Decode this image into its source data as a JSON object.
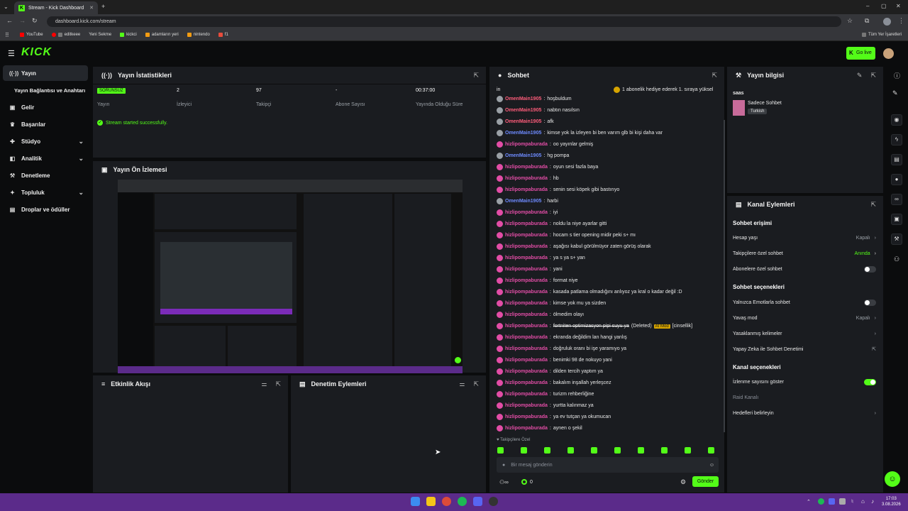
{
  "browser": {
    "tab_title": "Stream - Kick Dashboard",
    "url": "dashboard.kick.com/stream",
    "bookmarks": [
      "YouTube",
      "editkeee",
      "Yeni Sekme",
      "kickci",
      "adamların yeri",
      "nintendo",
      "f1"
    ],
    "all_bookmarks": "Tüm Yer İşaretleri"
  },
  "header": {
    "logo": "KICK",
    "go_live": "Go live"
  },
  "sidebar": {
    "items": [
      {
        "label": "Yayın",
        "icon": "broadcast-icon"
      },
      {
        "label": "Yayın Bağlantısı ve Anahtarı",
        "icon": ""
      },
      {
        "label": "Gelir",
        "icon": "wallet-icon"
      },
      {
        "label": "Başarılar",
        "icon": "trophy-icon"
      },
      {
        "label": "Stüdyo",
        "icon": "studio-icon"
      },
      {
        "label": "Analitik",
        "icon": "analytics-icon"
      },
      {
        "label": "Denetleme",
        "icon": "wrench-icon"
      },
      {
        "label": "Topluluk",
        "icon": "community-icon"
      },
      {
        "label": "Droplar ve ödüller",
        "icon": "gift-icon"
      }
    ]
  },
  "stats": {
    "title": "Yayın İstatistikleri",
    "status_badge": "SORUNSUZ",
    "status_label": "Yayın",
    "viewers": "2",
    "viewers_label": "İzleyici",
    "followers": "97",
    "followers_label": "Takipçi",
    "subs": "-",
    "subs_label": "Abone Sayısı",
    "duration": "00:37:00",
    "duration_label": "Yayında Olduğu Süre",
    "success": "Stream started successfully."
  },
  "preview": {
    "title": "Yayın Ön İzlemesi"
  },
  "activity": {
    "title": "Etkinlik Akışı"
  },
  "moderation": {
    "title": "Denetim Eylemleri"
  },
  "chat": {
    "title": "Sohbet",
    "partial_top": "in",
    "gift_banner": "1 abonelik hediye ederek 1. sıraya yüksel",
    "messages": [
      {
        "user": "OmenMain1905",
        "color": "red",
        "badge": "g",
        "text": "hoşbuldum"
      },
      {
        "user": "OmenMain1905",
        "color": "red",
        "badge": "g",
        "text": "nabtın nasılsın"
      },
      {
        "user": "OmenMain1905",
        "color": "red",
        "badge": "g",
        "text": "afk"
      },
      {
        "user": "OmenMain1905",
        "color": "blue",
        "badge": "g",
        "text": "kimse yok la izleyen bi ben varım glb bi kişi daha var"
      },
      {
        "user": "hizlipompaburada",
        "color": "pink",
        "badge": "p",
        "text": "oo yayınlar gelmiş"
      },
      {
        "user": "OmenMain1905",
        "color": "blue",
        "badge": "g",
        "text": "hg pompa"
      },
      {
        "user": "hizlipompaburada",
        "color": "pink",
        "badge": "p",
        "text": "oyun sesi fazla baya"
      },
      {
        "user": "hizlipompaburada",
        "color": "pink",
        "badge": "p",
        "text": "hb"
      },
      {
        "user": "hizlipompaburada",
        "color": "pink",
        "badge": "p",
        "text": "senin sesi köpek gibi bastırıyo"
      },
      {
        "user": "OmenMain1905",
        "color": "blue",
        "badge": "g",
        "text": "harbi"
      },
      {
        "user": "hizlipompaburada",
        "color": "pink",
        "badge": "p",
        "text": "iyi"
      },
      {
        "user": "hizlipompaburada",
        "color": "pink",
        "badge": "p",
        "text": "noldu la niye ayarlar gitti"
      },
      {
        "user": "hizlipompaburada",
        "color": "pink",
        "badge": "p",
        "text": "hocam s tier opening midir peki s+ mı"
      },
      {
        "user": "hizlipompaburada",
        "color": "pink",
        "badge": "p",
        "text": "aşağısı kabul görülmüyor zaten görüş olarak"
      },
      {
        "user": "hizlipompaburada",
        "color": "pink",
        "badge": "p",
        "text": "ya s ya s+ yan"
      },
      {
        "user": "hizlipompaburada",
        "color": "pink",
        "badge": "p",
        "text": "yani"
      },
      {
        "user": "hizlipompaburada",
        "color": "pink",
        "badge": "p",
        "text": "format niye"
      },
      {
        "user": "hizlipompaburada",
        "color": "pink",
        "badge": "p",
        "text": "kasada patlama olmadığını anlıyoz ya kral o kadar değil :D"
      },
      {
        "user": "hizlipompaburada",
        "color": "pink",
        "badge": "p",
        "text": "kimse yok mu ya sizden"
      },
      {
        "user": "hizlipompaburada",
        "color": "pink",
        "badge": "p",
        "text": "ölmedim olayı"
      },
      {
        "user": "hizlipompaburada",
        "color": "pink",
        "badge": "p",
        "text": "fortniten optimizasyon pipi suyu ya",
        "deleted": "(Deleted)",
        "tag": "AI Mod",
        "tag_extra": "[cinsellik]"
      },
      {
        "user": "hizlipompaburada",
        "color": "pink",
        "badge": "p",
        "text": "ekranda değildim lan hangi yanlış"
      },
      {
        "user": "hizlipompaburada",
        "color": "pink",
        "badge": "p",
        "text": "doğruluk oranı bi işe yaramıyo ya"
      },
      {
        "user": "hizlipompaburada",
        "color": "pink",
        "badge": "p",
        "text": "benimki 98 de nokuyo yani"
      },
      {
        "user": "hizlipompaburada",
        "color": "pink",
        "badge": "p",
        "text": "dilden tercih yaptım ya"
      },
      {
        "user": "hizlipompaburada",
        "color": "pink",
        "badge": "p",
        "text": "bakalım inşallah yerleşcez"
      },
      {
        "user": "hizlipompaburada",
        "color": "pink",
        "badge": "p",
        "text": "turizm rehberliğine"
      },
      {
        "user": "hizlipompaburada",
        "color": "pink",
        "badge": "p",
        "text": "yurtta kalınmaz ya"
      },
      {
        "user": "hizlipompaburada",
        "color": "pink",
        "badge": "p",
        "text": "ya ev tutçan ya okumucan"
      },
      {
        "user": "hizlipompaburada",
        "color": "pink",
        "badge": "p",
        "text": "aynen o şekil"
      }
    ],
    "followers_only": "Takipçilere Özel",
    "input_placeholder": "Bir mesaj gönderin",
    "points": "0",
    "send": "Gönder"
  },
  "stream_info": {
    "title": "Yayın bilgisi",
    "stream_title": "saas",
    "category": "Sadece Sohbet",
    "language": "Turkish"
  },
  "channel_actions": {
    "title": "Kanal Eylemleri",
    "chat_access": "Sohbet erişimi",
    "account_age": "Hesap yaşı",
    "account_age_val": "Kapalı",
    "followers_only": "Takipçilere özel sohbet",
    "followers_only_val": "Anında",
    "subs_only": "Abonelere özel sohbet",
    "chat_options": "Sohbet seçenekleri",
    "emotes_only": "Yalnızca Emotlarla sohbet",
    "slow_mode": "Yavaş mod",
    "slow_mode_val": "Kapalı",
    "banned_words": "Yasaklanmış kelimeler",
    "ai_moderation": "Yapay Zeka ile Sohbet Denetimi",
    "channel_options": "Kanal seçenekleri",
    "show_viewers": "İzlenme sayısını göster",
    "raid": "Raid Kanalı",
    "set_targets": "Hedefleri belirleyin"
  },
  "taskbar": {
    "time": "17:03",
    "date": "3.08.2026"
  },
  "colors": {
    "accent": "#53fc18",
    "panel": "#1a1c20",
    "bg": "#0b0c0d",
    "taskbar": "#5b2b8a"
  }
}
